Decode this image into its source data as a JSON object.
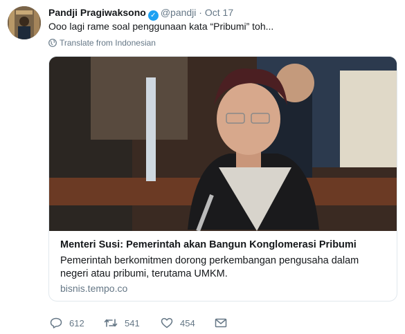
{
  "tweet": {
    "author_name": "Pandji Pragiwaksono",
    "handle": "@pandji",
    "separator": "·",
    "date": "Oct 17",
    "text": "Ooo lagi rame soal penggunaan kata “Pribumi” toh...",
    "translate_label": "Translate from Indonesian"
  },
  "card": {
    "title": "Menteri Susi: Pemerintah akan Bangun Konglomerasi Pribumi",
    "description": "Pemerintah berkomitmen dorong perkembangan pengusaha dalam negeri atau pribumi, terutama UMKM.",
    "domain": "bisnis.tempo.co"
  },
  "actions": {
    "replies": "612",
    "retweets": "541",
    "likes": "454"
  },
  "colors": {
    "accent": "#1da1f2",
    "muted": "#657786",
    "border": "#e1e8ed"
  }
}
